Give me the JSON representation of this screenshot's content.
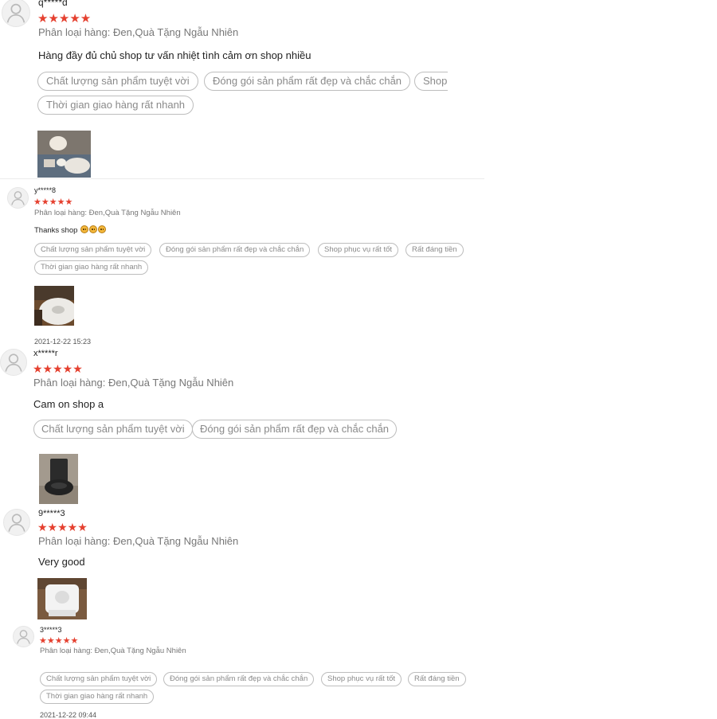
{
  "reviews": [
    {
      "user": "q*****d",
      "stars": "★★★★★",
      "variant": "Phân loại hàng: Đen,Quà Tặng Ngẫu Nhiên",
      "comment": "Hàng đầy đủ chủ shop tư vấn nhiệt tình cảm ơn shop nhiều",
      "tags": [
        "Chất lượng sản phẩm tuyệt vời",
        "Đóng gói sản phẩm rất đẹp và chắc chắn",
        "Shop",
        "Thời gian giao hàng rất nhanh"
      ]
    },
    {
      "user": "y*****8",
      "stars": "★★★★★",
      "variant": "Phân loại hàng: Đen,Quà Tặng Ngẫu Nhiên",
      "comment": "Thanks shop",
      "tags": [
        "Chất lượng sản phẩm tuyệt vời",
        "Đóng gói sản phẩm rất đẹp và chắc chắn",
        "Shop phục vụ rất tốt",
        "Rất đáng tiền",
        "Thời gian giao hàng rất nhanh"
      ],
      "timestamp": "2021-12-22 15:23"
    },
    {
      "user": "x*****r",
      "stars": "★★★★★",
      "variant": "Phân loại hàng: Đen,Quà Tặng Ngẫu Nhiên",
      "comment": "Cam on shop a",
      "tags": [
        "Chất lượng sản phẩm tuyệt vời",
        "Đóng gói sản phẩm rất đẹp và chắc chắn"
      ]
    },
    {
      "user": "9*****3",
      "stars": "★★★★★",
      "variant": "Phân loại hàng: Đen,Quà Tặng Ngẫu Nhiên",
      "comment": "Very good"
    },
    {
      "user": "3*****3",
      "stars": "★★★★★",
      "variant": "Phân loại hàng: Đen,Quà Tặng Ngẫu Nhiên",
      "tags": [
        "Chất lượng sản phẩm tuyệt vời",
        "Đóng gói sản phẩm rất đẹp và chắc chắn",
        "Shop phục vụ rất tốt",
        "Rất đáng tiền",
        "Thời gian giao hàng rất nhanh"
      ],
      "timestamp": "2021-12-22 09:44"
    }
  ],
  "icons": {
    "avatar": "user-avatar-icon",
    "star": "star-icon",
    "emoji": "smiling-face-emoji"
  },
  "colors": {
    "star": "#e5402f",
    "tag_border": "#bdbdbd",
    "tag_text": "#8a8a8a",
    "variant_text": "#777777"
  }
}
